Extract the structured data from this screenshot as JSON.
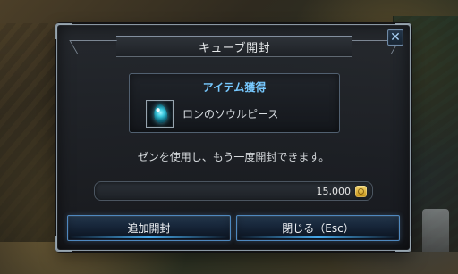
{
  "dialog": {
    "title": "キューブ開封",
    "close_label": "✕",
    "item": {
      "heading": "アイテム獲得",
      "name": "ロンのソウルピース",
      "icon": "soul-piece-icon"
    },
    "message": "ゼンを使用し、もう一度開封できます。",
    "cost": {
      "value": "15,000",
      "currency_icon": "zen-coin-icon"
    },
    "buttons": {
      "open_again": "追加開封",
      "close": "閉じる（Esc）"
    },
    "colors": {
      "accent": "#77c9ff",
      "button_border": "#4f88be",
      "frame": "#8b98a3"
    }
  }
}
